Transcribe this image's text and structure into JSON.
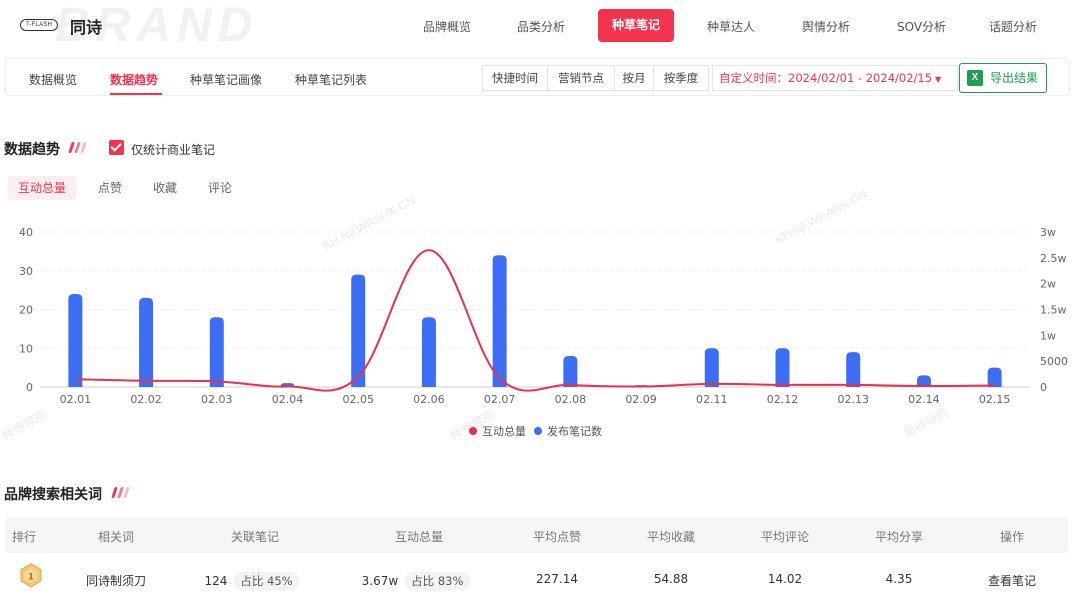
{
  "brand": {
    "logo_text": "T-FLASH",
    "name": "同诗",
    "watermark": "BRAND"
  },
  "topnav": {
    "items": [
      "品牌概览",
      "品类分析",
      "种草笔记",
      "种草达人",
      "舆情分析",
      "SOV分析",
      "话题分析"
    ],
    "active": "种草笔记"
  },
  "subnav": {
    "tabs": [
      "数据概览",
      "数据趋势",
      "种草笔记画像",
      "种草笔记列表"
    ],
    "active": "数据趋势",
    "periods": [
      "快捷时间",
      "营销节点",
      "按月",
      "按季度"
    ],
    "custom_time_label": "自定义时间：2024/02/01 - 2024/02/15",
    "export_label": "导出结果",
    "export_icon": "excel-icon"
  },
  "trend": {
    "title": "数据趋势",
    "checkbox_label": "仅统计商业笔记",
    "checkbox_checked": true,
    "metric_tabs": [
      "互动总量",
      "点赞",
      "收藏",
      "评论"
    ],
    "active_metric": "互动总量"
  },
  "chart_data": {
    "type": "bar",
    "categories": [
      "02.01",
      "02.02",
      "02.03",
      "02.04",
      "02.05",
      "02.06",
      "02.07",
      "02.08",
      "02.09",
      "02.11",
      "02.12",
      "02.13",
      "02.14",
      "02.15"
    ],
    "series": [
      {
        "name": "互动总量",
        "type": "line",
        "axis": "right",
        "color": "#e8304f",
        "values": [
          1500,
          1200,
          1100,
          100,
          2000,
          26500,
          1700,
          400,
          100,
          600,
          400,
          400,
          200,
          300
        ]
      },
      {
        "name": "发布笔记数",
        "type": "bar",
        "axis": "left",
        "color": "#3b6ef5",
        "values": [
          24,
          23,
          18,
          1,
          29,
          18,
          34,
          8,
          0.5,
          10,
          10,
          9,
          3,
          5
        ]
      }
    ],
    "ylim_left": [
      0,
      40
    ],
    "left_ticks": [
      "0",
      "10",
      "20",
      "30",
      "40"
    ],
    "ylim_right": [
      0,
      30000
    ],
    "right_ticks": [
      "0",
      "5000",
      "1w",
      "1.5w",
      "2w",
      "2.5w",
      "3w"
    ],
    "grid": true,
    "legend_position": "bottom"
  },
  "watermarks": [
    "KH.NEWRANK.CN",
    "新榜导购"
  ],
  "search_words": {
    "title": "品牌搜索相关词",
    "columns": [
      "排行",
      "相关词",
      "关联笔记",
      "互动总量",
      "平均点赞",
      "平均收藏",
      "平均评论",
      "平均分享",
      "操作"
    ],
    "rows": [
      {
        "rank": "1",
        "word": "同诗制须刀",
        "notes": "124",
        "notes_share": "占比 45%",
        "interactions": "3.67w",
        "interactions_share": "占比 83%",
        "avg_likes": "227.14",
        "avg_collects": "54.88",
        "avg_comments": "14.02",
        "avg_shares": "4.35",
        "action": "查看笔记"
      }
    ]
  }
}
